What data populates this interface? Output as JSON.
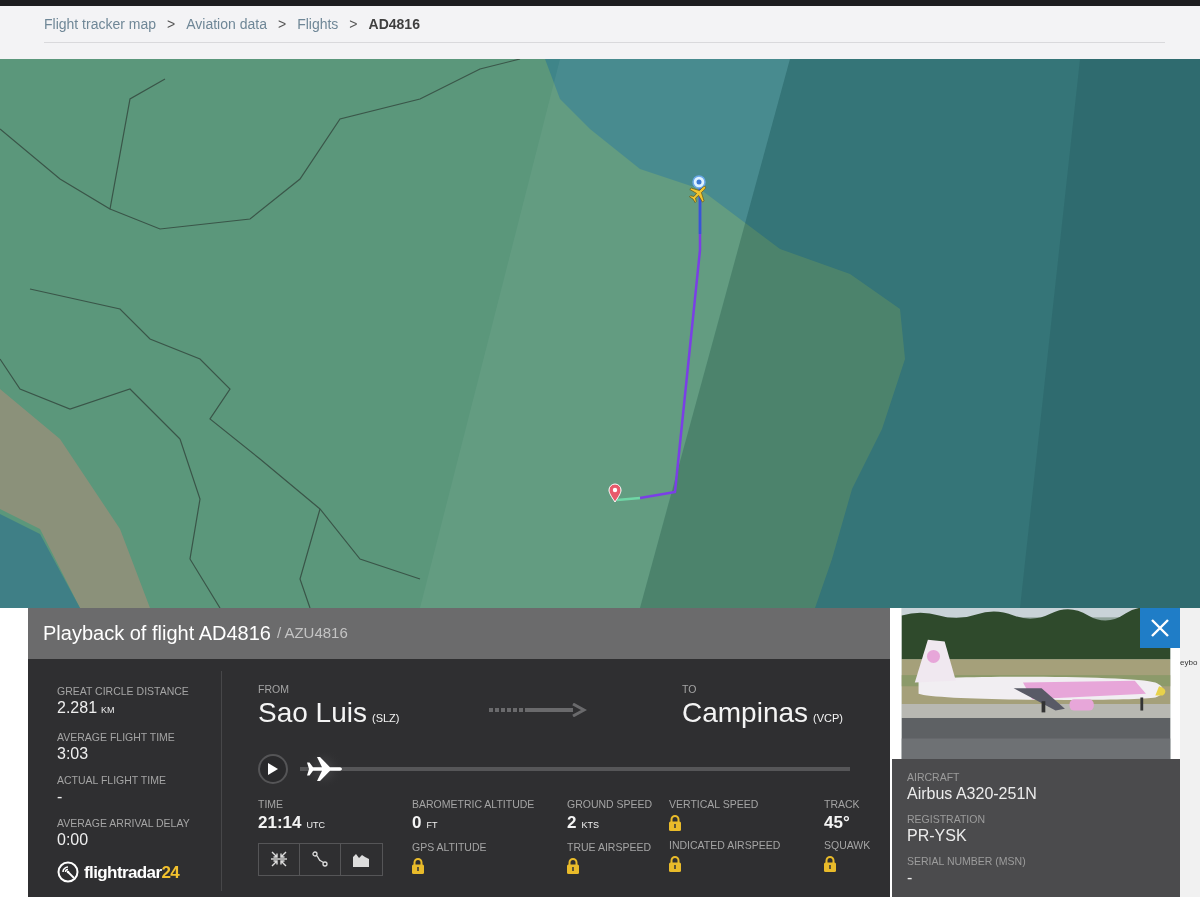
{
  "breadcrumb": {
    "separator": ">",
    "items": [
      {
        "label": "Flight tracker map",
        "current": false
      },
      {
        "label": "Aviation data",
        "current": false
      },
      {
        "label": "Flights",
        "current": false
      },
      {
        "label": "AD4816",
        "current": true
      }
    ]
  },
  "playback_panel": {
    "title": "Playback of flight AD4816",
    "subtitle": "/ AZU4816",
    "stats": [
      {
        "label": "GREAT CIRCLE DISTANCE",
        "value": "2.281",
        "unit": "KM"
      },
      {
        "label": "AVERAGE FLIGHT TIME",
        "value": "3:03"
      },
      {
        "label": "ACTUAL FLIGHT TIME",
        "value": "-"
      },
      {
        "label": "AVERAGE ARRIVAL DELAY",
        "value": "0:00"
      }
    ],
    "logo": {
      "text": "flightradar",
      "suffix": "24"
    },
    "from": {
      "label": "FROM",
      "city": "Sao Luis",
      "code": "(SLZ)"
    },
    "to": {
      "label": "TO",
      "city": "Campinas",
      "code": "(VCP)"
    },
    "playback": {
      "level": 0
    },
    "time": {
      "label": "TIME",
      "value": "21:14",
      "unit": "UTC"
    },
    "tools": [
      {
        "kind": "collapse"
      },
      {
        "kind": "route"
      },
      {
        "kind": "chart"
      }
    ],
    "telemetry": [
      {
        "items": [
          {
            "label": "BAROMETRIC ALTITUDE",
            "locked": false,
            "value": "0",
            "unit": "FT"
          },
          {
            "label": "GPS ALTITUDE",
            "locked": true
          }
        ]
      },
      {
        "items": [
          {
            "label": "GROUND SPEED",
            "locked": false,
            "value": "2",
            "unit": "KTS"
          },
          {
            "label": "TRUE AIRSPEED",
            "locked": true
          }
        ]
      },
      {
        "items": [
          {
            "label": "VERTICAL SPEED",
            "locked": true
          },
          {
            "label": "INDICATED AIRSPEED",
            "locked": true
          }
        ]
      },
      {
        "items": [
          {
            "label": "TRACK",
            "locked": false,
            "value": "45°"
          },
          {
            "label": "SQUAWK",
            "locked": true
          }
        ]
      }
    ]
  },
  "aircraft": {
    "fields": [
      {
        "label": "AIRCRAFT",
        "value": "Airbus A320-251N"
      },
      {
        "label": "REGISTRATION",
        "value": "PR-YSK"
      },
      {
        "label": "SERIAL NUMBER (MSN)",
        "value": "-"
      }
    ]
  },
  "edge_text": "eybo"
}
